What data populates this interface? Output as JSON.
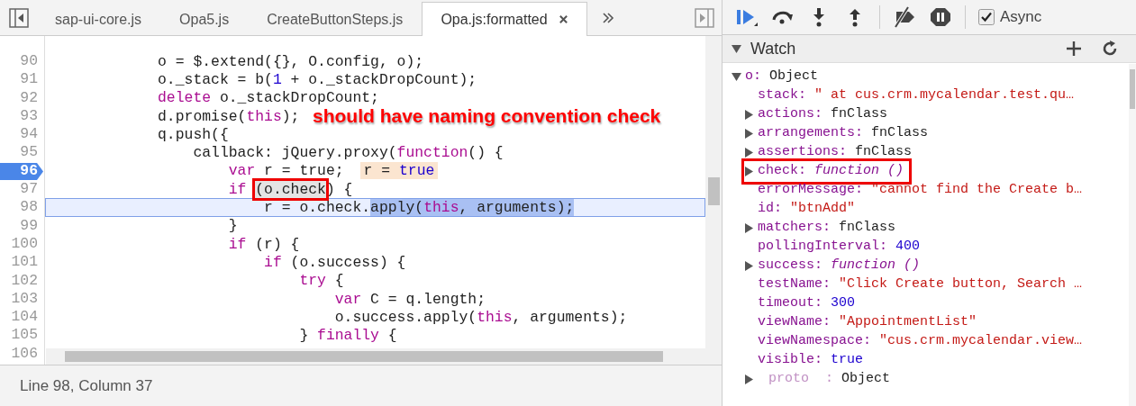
{
  "tabs": [
    {
      "label": "sap-ui-core.js",
      "selected": false
    },
    {
      "label": "Opa5.js",
      "selected": false
    },
    {
      "label": "CreateButtonSteps.js",
      "selected": false
    },
    {
      "label": "Opa.js:formatted",
      "selected": true
    }
  ],
  "editor": {
    "annotation": "should have naming convention check",
    "lines": [
      {
        "number": "90",
        "tokens": [
          {
            "text": "            o = $.extend({}, O.config, o);",
            "kind": "plain"
          }
        ]
      },
      {
        "number": "91",
        "tokens": [
          {
            "text": "            o._stack = b(",
            "kind": "plain"
          },
          {
            "text": "1",
            "kind": "number"
          },
          {
            "text": " + o._stackDropCount);",
            "kind": "plain"
          }
        ]
      },
      {
        "number": "92",
        "tokens": [
          {
            "text": "            delete",
            "kind": "keyword"
          },
          {
            "text": " o._stackDropCount;",
            "kind": "plain"
          }
        ]
      },
      {
        "number": "93",
        "tokens": [
          {
            "text": "            d.promise(",
            "kind": "plain"
          },
          {
            "text": "this",
            "kind": "keyword"
          },
          {
            "text": ");",
            "kind": "plain"
          }
        ]
      },
      {
        "number": "94",
        "tokens": [
          {
            "text": "            q.push({",
            "kind": "plain"
          }
        ]
      },
      {
        "number": "95",
        "tokens": [
          {
            "text": "                callback: jQuery.proxy(",
            "kind": "plain"
          },
          {
            "text": "function",
            "kind": "keyword"
          },
          {
            "text": "() {",
            "kind": "plain"
          }
        ]
      },
      {
        "number": "96",
        "breakpoint": true,
        "tokens": [
          {
            "text": "                    var",
            "kind": "keyword"
          },
          {
            "text": " r = true;",
            "kind": "plain"
          }
        ],
        "inline_value": [
          {
            "text": "r = ",
            "kind": "plain"
          },
          {
            "text": "true",
            "kind": "number"
          }
        ]
      },
      {
        "number": "97",
        "tokens": [
          {
            "text": "                    if ",
            "kind": "keyword"
          },
          {
            "text": "(o.check",
            "kind": "boxed"
          },
          {
            "text": ") {",
            "kind": "plain"
          }
        ]
      },
      {
        "number": "98",
        "current": true,
        "tokens": [
          {
            "text": "                        r = o.check.",
            "kind": "plain"
          },
          {
            "text": "apply(",
            "kind": "selected"
          },
          {
            "text": "this",
            "kind": "selected_keyword"
          },
          {
            "text": ", arguments);",
            "kind": "selected"
          }
        ]
      },
      {
        "number": "99",
        "tokens": [
          {
            "text": "                    }",
            "kind": "plain"
          }
        ]
      },
      {
        "number": "100",
        "tokens": [
          {
            "text": "                    if",
            "kind": "keyword"
          },
          {
            "text": " (r) {",
            "kind": "plain"
          }
        ]
      },
      {
        "number": "101",
        "tokens": [
          {
            "text": "                        if",
            "kind": "keyword"
          },
          {
            "text": " (o.success) {",
            "kind": "plain"
          }
        ]
      },
      {
        "number": "102",
        "tokens": [
          {
            "text": "                            try",
            "kind": "keyword"
          },
          {
            "text": " {",
            "kind": "plain"
          }
        ]
      },
      {
        "number": "103",
        "tokens": [
          {
            "text": "                                var",
            "kind": "keyword"
          },
          {
            "text": " C = q.length;",
            "kind": "plain"
          }
        ]
      },
      {
        "number": "104",
        "tokens": [
          {
            "text": "                                o.success.apply(",
            "kind": "plain"
          },
          {
            "text": "this",
            "kind": "keyword"
          },
          {
            "text": ", arguments);",
            "kind": "plain"
          }
        ]
      },
      {
        "number": "105",
        "tokens": [
          {
            "text": "                            } ",
            "kind": "plain"
          },
          {
            "text": "finally",
            "kind": "keyword"
          },
          {
            "text": " {",
            "kind": "plain"
          }
        ]
      },
      {
        "number": "106"
      }
    ]
  },
  "status_bar": "Line 98, Column 37",
  "debugger": {
    "async": {
      "label": "Async",
      "checked": true
    },
    "watch": {
      "title": "Watch",
      "expanded": true,
      "items": [
        {
          "name": "o:",
          "value": "Object",
          "kind": "object",
          "expanded": true,
          "children": [
            {
              "name": "stack:",
              "value": "\" at cus.crm.mycalendar.test.qu…",
              "kind": "string"
            },
            {
              "name": "actions:",
              "value": "fnClass",
              "kind": "object",
              "expanded": false
            },
            {
              "name": "arrangements:",
              "value": "fnClass",
              "kind": "object",
              "expanded": false
            },
            {
              "name": "assertions:",
              "value": "fnClass",
              "kind": "object",
              "expanded": false
            },
            {
              "name": "check:",
              "value": "function ()",
              "kind": "function",
              "expanded": false,
              "boxed": true
            },
            {
              "name": "errorMessage:",
              "value": "\"cannot find the Create b…",
              "kind": "string"
            },
            {
              "name": "id:",
              "value": "\"btnAdd\"",
              "kind": "string"
            },
            {
              "name": "matchers:",
              "value": "fnClass",
              "kind": "object",
              "expanded": false
            },
            {
              "name": "pollingInterval:",
              "value": "400",
              "kind": "number"
            },
            {
              "name": "success:",
              "value": "function ()",
              "kind": "function",
              "expanded": false
            },
            {
              "name": "testName:",
              "value": "\"Click Create button, Search …",
              "kind": "string"
            },
            {
              "name": "timeout:",
              "value": "300",
              "kind": "number"
            },
            {
              "name": "viewName:",
              "value": "\"AppointmentList\"",
              "kind": "string"
            },
            {
              "name": "viewNamespace:",
              "value": "\"cus.crm.mycalendar.view…",
              "kind": "string"
            },
            {
              "name": "visible:",
              "value": "true",
              "kind": "number"
            },
            {
              "name": "proto  :",
              "value": "Object",
              "kind": "object",
              "expanded": false,
              "internal": true
            }
          ]
        }
      ]
    }
  }
}
